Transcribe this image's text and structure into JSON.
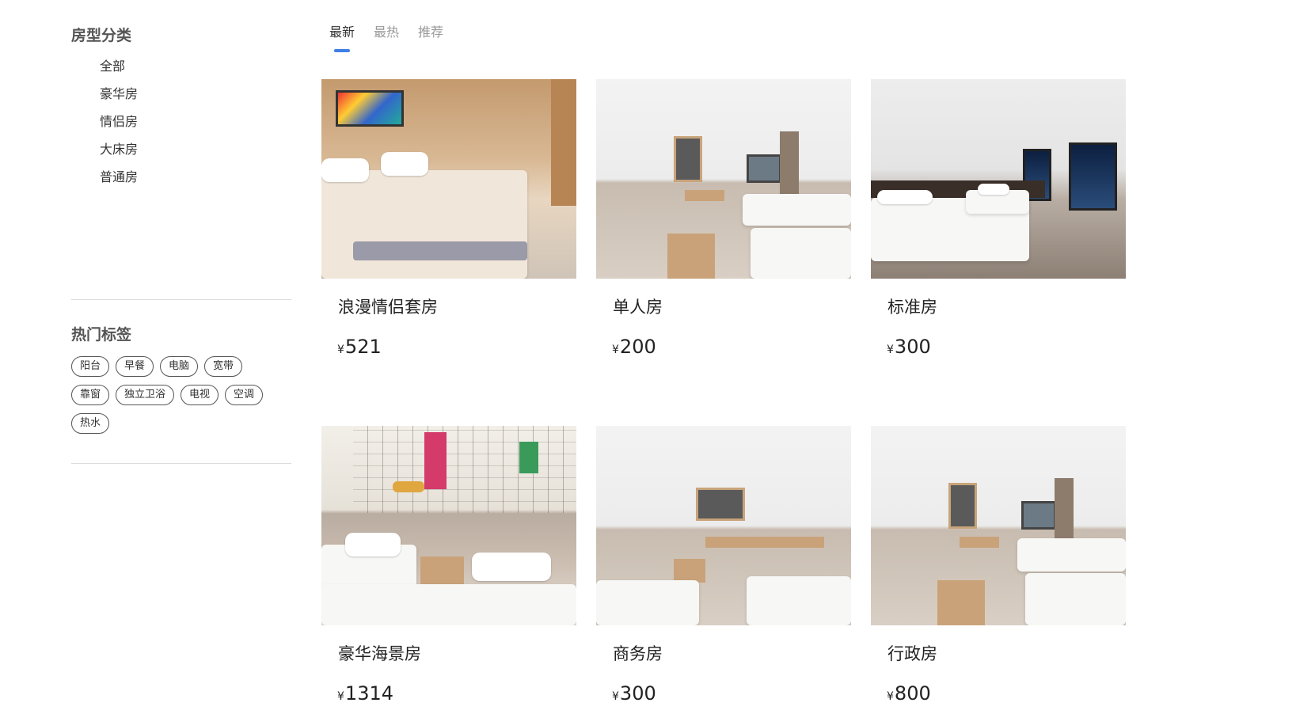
{
  "sidebar": {
    "category_title": "房型分类",
    "categories": [
      "全部",
      "豪华房",
      "情侣房",
      "大床房",
      "普通房"
    ],
    "tags_title": "热门标签",
    "tags": [
      "阳台",
      "早餐",
      "电脑",
      "宽带",
      "靠窗",
      "独立卫浴",
      "电视",
      "空调",
      "热水"
    ]
  },
  "tabs": [
    {
      "label": "最新",
      "active": true
    },
    {
      "label": "最热",
      "active": false
    },
    {
      "label": "推荐",
      "active": false
    }
  ],
  "currency_symbol": "¥",
  "accent_color": "#3f7fe6",
  "rooms": [
    {
      "name": "浪漫情侣套房",
      "price": "521"
    },
    {
      "name": "单人房",
      "price": "200"
    },
    {
      "name": "标准房",
      "price": "300"
    },
    {
      "name": "豪华海景房",
      "price": "1314"
    },
    {
      "name": "商务房",
      "price": "300"
    },
    {
      "name": "行政房",
      "price": "800"
    }
  ]
}
